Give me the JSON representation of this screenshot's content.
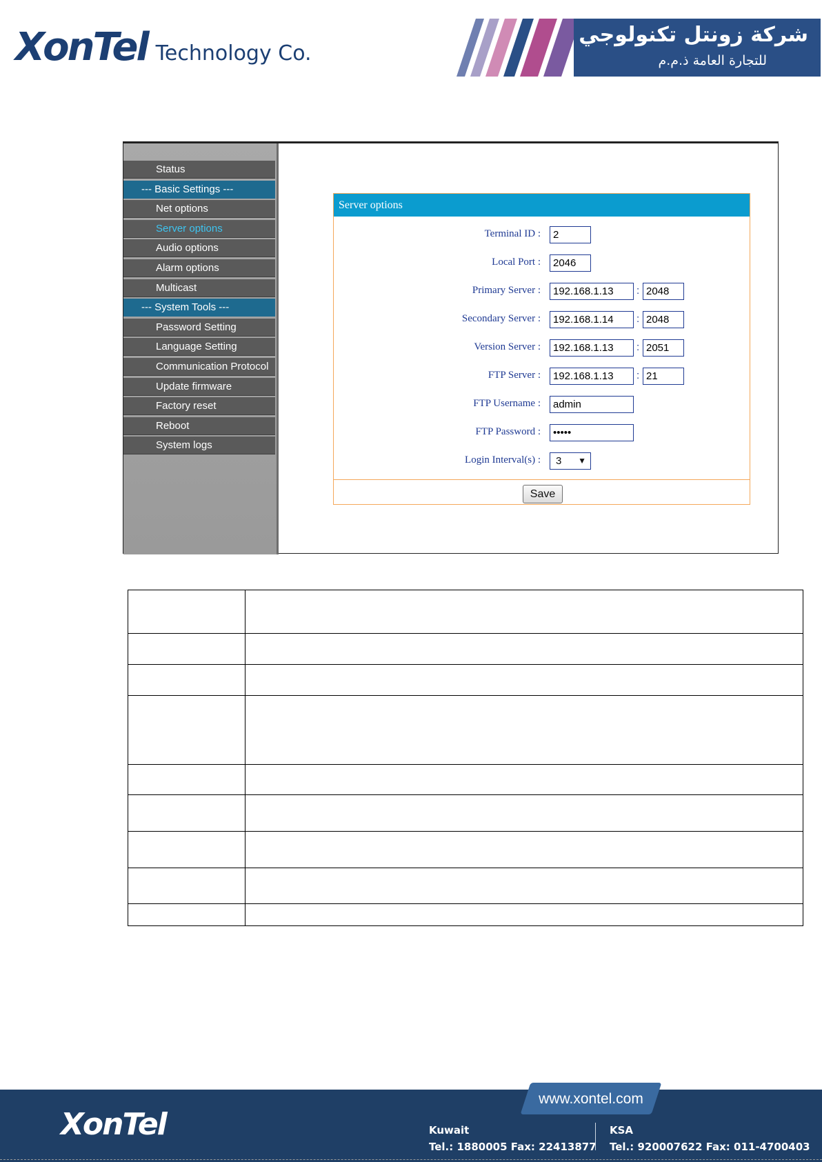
{
  "header": {
    "logo_text": "XonTel",
    "logo_subtitle": "Technology Co.",
    "arabic_title": "شركة زونتل تكنولوجي",
    "arabic_subtitle": "للتجارة العامة ذ.م.م"
  },
  "sidebar": {
    "items": [
      {
        "label": "Status",
        "type": "item"
      },
      {
        "label": "--- Basic Settings ---",
        "type": "section"
      },
      {
        "label": "Net options",
        "type": "item"
      },
      {
        "label": "Server options",
        "type": "item",
        "active": true
      },
      {
        "label": "Audio options",
        "type": "item"
      },
      {
        "label": "Alarm options",
        "type": "item"
      },
      {
        "label": "Multicast",
        "type": "item"
      },
      {
        "label": "--- System Tools ---",
        "type": "section"
      },
      {
        "label": "Password Setting",
        "type": "item"
      },
      {
        "label": "Language Setting",
        "type": "item"
      },
      {
        "label": "Communication Protocol",
        "type": "item"
      },
      {
        "label": "Update firmware",
        "type": "item"
      },
      {
        "label": "Factory reset",
        "type": "item"
      },
      {
        "label": "Reboot",
        "type": "item"
      },
      {
        "label": "System logs",
        "type": "item"
      }
    ]
  },
  "panel": {
    "title": "Server options",
    "fields": {
      "terminal_id": {
        "label": "Terminal ID :",
        "value": "2"
      },
      "local_port": {
        "label": "Local Port :",
        "value": "2046"
      },
      "primary_server": {
        "label": "Primary Server :",
        "host": "192.168.1.13",
        "port": "2048"
      },
      "secondary_server": {
        "label": "Secondary Server :",
        "host": "192.168.1.14",
        "port": "2048"
      },
      "version_server": {
        "label": "Version Server :",
        "host": "192.168.1.13",
        "port": "2051"
      },
      "ftp_server": {
        "label": "FTP Server :",
        "host": "192.168.1.13",
        "port": "21"
      },
      "ftp_username": {
        "label": "FTP Username :",
        "value": "admin"
      },
      "ftp_password": {
        "label": "FTP Password :",
        "value": "•••••"
      },
      "login_interval": {
        "label": "Login Interval(s) :",
        "value": "3"
      }
    },
    "colon": ":",
    "save_label": "Save",
    "select_arrow": "▼"
  },
  "footer": {
    "logo_text": "XonTel",
    "url": "www.xontel.com",
    "kuwait": {
      "name": "Kuwait",
      "tel": "Tel.: 1880005  Fax: 22413877"
    },
    "ksa": {
      "name": "KSA",
      "tel": "Tel.: 920007622  Fax: 011-4700403"
    }
  },
  "colors": {
    "brand": "#1c3f73",
    "panel_header": "#0b9ccf",
    "panel_border": "#f4a85a",
    "active_menu": "#3ec4f0",
    "footer_bg": "#1f3f66"
  }
}
